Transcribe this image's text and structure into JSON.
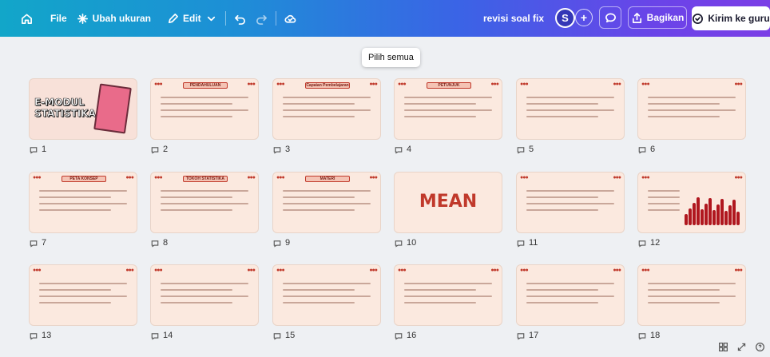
{
  "topbar": {
    "file": "File",
    "resize": "Ubah ukuran",
    "edit": "Edit",
    "doc_title": "revisi soal fix",
    "avatar_initial": "S",
    "share": "Bagikan",
    "send": "Kirim ke guru"
  },
  "tooltip": "Pilih semua",
  "pages": [
    {
      "num": "1",
      "headline": "E-MODUL STATISTIKA"
    },
    {
      "num": "2",
      "headline": "PENDAHULUAN"
    },
    {
      "num": "3",
      "headline": "Capaian Pembelajaran"
    },
    {
      "num": "4",
      "headline": "PETUNJUK"
    },
    {
      "num": "5",
      "headline": ""
    },
    {
      "num": "6",
      "headline": ""
    },
    {
      "num": "7",
      "headline": "PETA KONSEP"
    },
    {
      "num": "8",
      "headline": "TOKOH STATISTIKA"
    },
    {
      "num": "9",
      "headline": "MATERI"
    },
    {
      "num": "10",
      "headline": "MEAN"
    },
    {
      "num": "11",
      "headline": ""
    },
    {
      "num": "12",
      "headline": ""
    },
    {
      "num": "13",
      "headline": ""
    },
    {
      "num": "14",
      "headline": ""
    },
    {
      "num": "15",
      "headline": ""
    },
    {
      "num": "16",
      "headline": ""
    },
    {
      "num": "17",
      "headline": ""
    },
    {
      "num": "18",
      "headline": ""
    }
  ],
  "colors": {
    "accent": "#c0392b",
    "slide_bg": "#fbe9df",
    "brand_start": "#12a6c9",
    "brand_end": "#7b3ee6"
  }
}
